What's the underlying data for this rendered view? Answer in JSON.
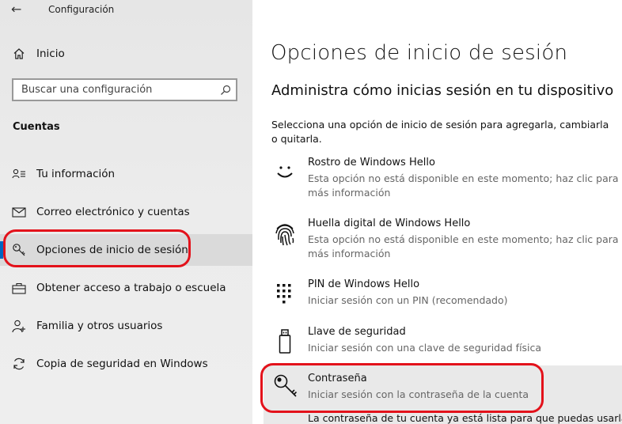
{
  "app": {
    "title": "Configuración",
    "back_icon": "back-arrow-icon"
  },
  "sidebar": {
    "home": "Inicio",
    "search_placeholder": "Buscar una configuración",
    "section": "Cuentas",
    "items": [
      {
        "label": "Tu información",
        "icon": "person-card-icon"
      },
      {
        "label": "Correo electrónico y cuentas",
        "icon": "mail-icon"
      },
      {
        "label": "Opciones de inicio de sesión",
        "icon": "key-icon",
        "selected": true
      },
      {
        "label": "Obtener acceso a trabajo o escuela",
        "icon": "briefcase-icon"
      },
      {
        "label": "Familia y otros usuarios",
        "icon": "person-add-icon"
      },
      {
        "label": "Copia de seguridad en Windows",
        "icon": "sync-icon"
      }
    ]
  },
  "main": {
    "title": "Opciones de inicio de sesión",
    "subtitle": "Administra cómo inicias sesión en tu dispositivo",
    "description": "Selecciona una opción de inicio de sesión para agregarla, cambiarla o quitarla.",
    "options": [
      {
        "title": "Rostro de Windows Hello",
        "subtitle": "Esta opción no está disponible en este momento; haz clic para más información",
        "icon": "smiley-face-icon"
      },
      {
        "title": "Huella digital de Windows Hello",
        "subtitle": "Esta opción no está disponible en este momento; haz clic para más información",
        "icon": "fingerprint-icon"
      },
      {
        "title": "PIN de Windows Hello",
        "subtitle": "Iniciar sesión con un PIN (recomendado)",
        "icon": "keypad-icon"
      },
      {
        "title": "Llave de seguridad",
        "subtitle": "Iniciar sesión con una clave de seguridad física",
        "icon": "usb-key-icon"
      },
      {
        "title": "Contraseña",
        "subtitle": "Iniciar sesión con la contraseña de la cuenta",
        "icon": "key-icon",
        "selected": true
      }
    ],
    "bottom_text": "La contraseña de tu cuenta ya está lista para que puedas usarla"
  },
  "colors": {
    "annotation": "#e3121b",
    "accent": "#0067c0"
  }
}
